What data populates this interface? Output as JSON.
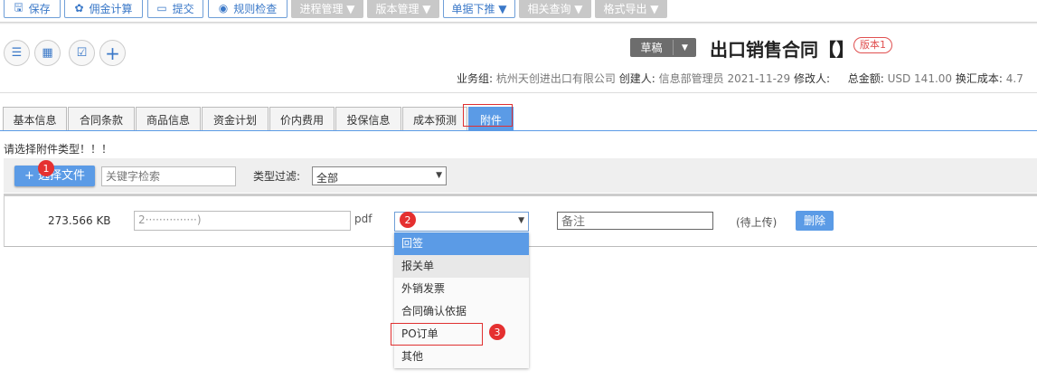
{
  "toolbar": [
    {
      "label": "保存",
      "icon": "save-icon",
      "glyph": "🖫",
      "style": "outline"
    },
    {
      "label": "佣金计算",
      "icon": "gear-icon",
      "glyph": "✿",
      "style": "outline"
    },
    {
      "label": "提交",
      "icon": "square-icon",
      "glyph": "▭",
      "style": "outline"
    },
    {
      "label": "规则检查",
      "icon": "eye-icon",
      "glyph": "◉",
      "style": "outline"
    },
    {
      "label": "进程管理 ▼",
      "style": "gray"
    },
    {
      "label": "版本管理 ▼",
      "style": "gray"
    },
    {
      "label": "单据下推 ▼",
      "style": "outline"
    },
    {
      "label": "相关查询 ▼",
      "style": "gray"
    },
    {
      "label": "格式导出 ▼",
      "style": "gray"
    }
  ],
  "quick_icons": [
    {
      "icon": "list-icon",
      "glyph": "☰"
    },
    {
      "icon": "calendar-icon",
      "glyph": "▦"
    },
    {
      "icon": "clipboard-check-icon",
      "glyph": "☑"
    },
    {
      "icon": "plus-icon",
      "glyph": "+"
    }
  ],
  "header": {
    "status": "草稿",
    "status_arrow": "▼",
    "title": "出口销售合同【】",
    "version": "版本1",
    "info": {
      "group_label": "业务组:",
      "group": "杭州天创进出口有限公司",
      "creator_label": "创建人:",
      "creator": "信息部管理员",
      "date": "2021-11-29",
      "modifier_label": "修改人:",
      "total_label": "总金额:",
      "total": "USD 141.00",
      "exch_label": "换汇成本:",
      "exch": "4.7"
    }
  },
  "tabs": [
    "基本信息",
    "合同条款",
    "商品信息",
    "资金计划",
    "价内费用",
    "投保信息",
    "成本预测",
    "附件"
  ],
  "active_tab": 7,
  "attachments": {
    "warning": "请选择附件类型！！！",
    "select_file": "+ 选择文件",
    "search_placeholder": "关键字检索",
    "filter_label": "类型过滤:",
    "filter_value": "全部",
    "row": {
      "size": "273.566 KB",
      "filename": "2···············)",
      "ext": "pdf",
      "type_value": "",
      "note_placeholder": "备注",
      "status": "(待上传)",
      "delete": "删除"
    },
    "type_options": [
      "回签",
      "报关单",
      "外销发票",
      "合同确认依据",
      "PO订单",
      "其他"
    ],
    "highlighted_option": 0
  },
  "annotations": [
    "1",
    "2",
    "3"
  ],
  "colors": {
    "accent": "#5b9be6",
    "annotation": "#e53030"
  }
}
